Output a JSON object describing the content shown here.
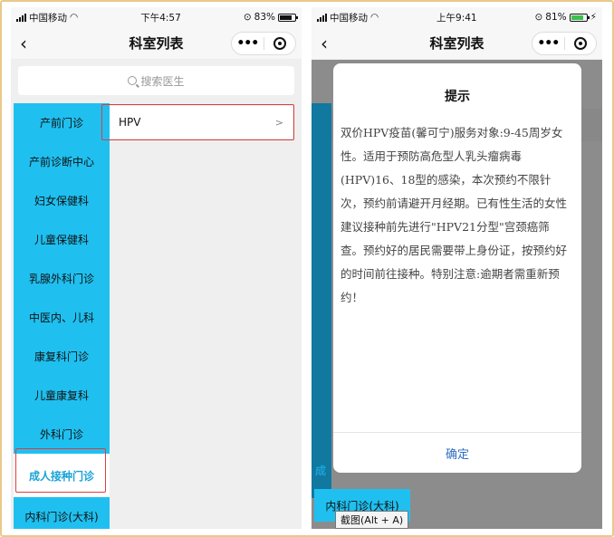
{
  "left": {
    "status": {
      "carrier": "中国移动",
      "time": "下午4:57",
      "battery": "83%"
    },
    "nav": {
      "title": "科室列表",
      "back": "‹",
      "more": "•••"
    },
    "search": {
      "placeholder": "搜索医生"
    },
    "departments": [
      "产前门诊",
      "产前诊断中心",
      "妇女保健科",
      "儿童保健科",
      "乳腺外科门诊",
      "中医内、儿科",
      "康复科门诊",
      "儿童康复科",
      "外科门诊",
      "成人接种门诊",
      "内科门诊(大科)"
    ],
    "active_department": "成人接种门诊",
    "clinics": [
      {
        "label": "HPV",
        "chevron": ">"
      }
    ]
  },
  "right": {
    "status": {
      "carrier": "中国移动",
      "time": "上午9:41",
      "battery": "81%"
    },
    "nav": {
      "title": "科室列表",
      "back": "‹",
      "more": "•••"
    },
    "dialog": {
      "title": "提示",
      "text": "双价HPV疫苗(馨可宁)服务对象:9-45周岁女性。适用于预防高危型人乳头瘤病毒(HPV)16、18型的感染，本次预约不限针次，预约前请避开月经期。已有性生活的女性建议接种前先进行\"HPV21分型\"宫颈癌筛查。预约好的居民需要带上身份证，按预约好的时间前往接种。特别注意:逾期者需重新预约！",
      "confirm": "确定"
    },
    "partial_label": "成",
    "bottom_item": "内科门诊(大科)",
    "tooltip": "截图(Alt + A)"
  },
  "colors": {
    "sidebar": "#1fc0f0",
    "active_text": "#1aa3d6",
    "highlight": "#e03c3c",
    "confirm": "#2d6dbf"
  }
}
